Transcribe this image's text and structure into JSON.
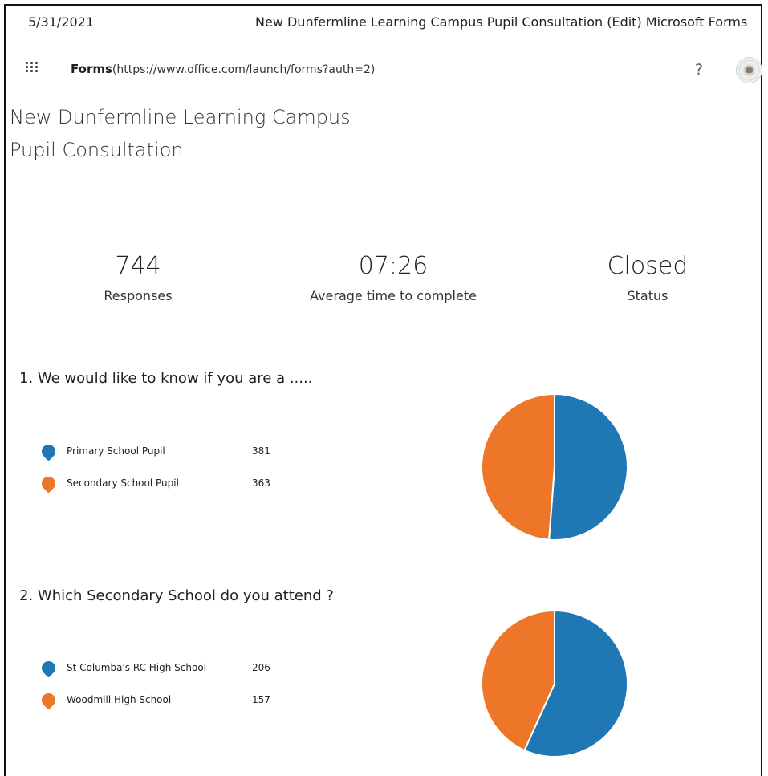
{
  "print_header": {
    "date": "5/31/2021",
    "title": "New Dunfermline Learning Campus Pupil Consultation (Edit) Microsoft Forms"
  },
  "appbar": {
    "brand": "Forms",
    "url": "(https://www.office.com/launch/forms?auth=2)",
    "help": "?",
    "icons": {
      "waffle": "waffle-icon",
      "help": "help-icon",
      "avatar": "avatar"
    }
  },
  "form": {
    "title_line1": "New Dunfermline Learning Campus",
    "title_line2": "Pupil Consultation"
  },
  "stats": [
    {
      "value": "744",
      "label": "Responses"
    },
    {
      "value": "07:26",
      "label": "Average time to complete"
    },
    {
      "value": "Closed",
      "label": "Status"
    }
  ],
  "colors": {
    "blue": "#1f77b4",
    "orange": "#ee7629"
  },
  "questions": [
    {
      "title": "1.  We would like to know if you are a ....."
    },
    {
      "title": "2.  Which Secondary School do you attend ?"
    }
  ],
  "chart_data": [
    {
      "type": "pie",
      "categories": [
        "Primary School Pupil",
        "Secondary School Pupil"
      ],
      "values": [
        381,
        363
      ],
      "colors": [
        "#1f77b4",
        "#ee7629"
      ]
    },
    {
      "type": "pie",
      "categories": [
        "St Columba's RC High School",
        "Woodmill High School"
      ],
      "values": [
        206,
        157
      ],
      "colors": [
        "#1f77b4",
        "#ee7629"
      ]
    }
  ]
}
